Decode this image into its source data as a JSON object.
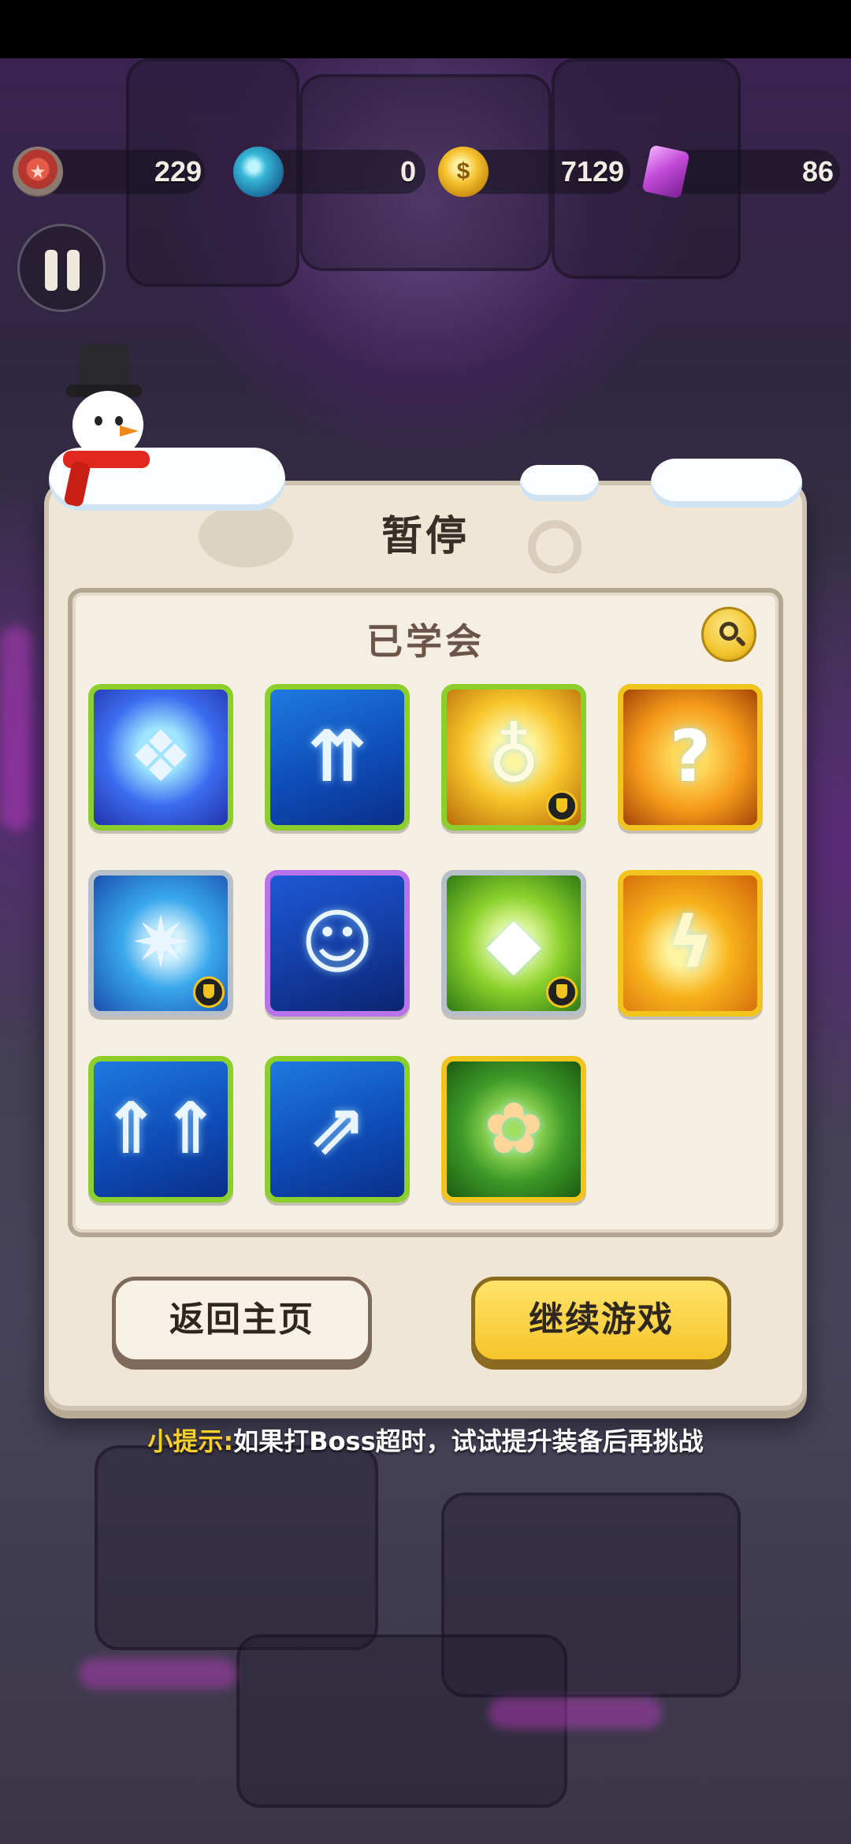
{
  "hud": {
    "medals": "229",
    "orbs": "0",
    "coins": "7129",
    "gems": "86"
  },
  "dialog": {
    "title": "暂停",
    "learned_title": "已学会"
  },
  "skills": [
    {
      "name": "ice-crystal-skill",
      "rarity": "green",
      "icon": "ice-cube-icon",
      "shield": false
    },
    {
      "name": "triple-arrow-up-skill",
      "rarity": "green",
      "icon": "triple-arrow-up-icon",
      "shield": false
    },
    {
      "name": "angel-bubble-skill",
      "rarity": "green",
      "icon": "angel-bubble-icon",
      "shield": true
    },
    {
      "name": "mystery-hammer-skill",
      "rarity": "gold",
      "icon": "hammer-question-icon",
      "shield": false
    },
    {
      "name": "frost-star-skill",
      "rarity": "silver",
      "icon": "frost-star-icon",
      "shield": true
    },
    {
      "name": "demon-spirit-skill",
      "rarity": "purple",
      "icon": "demon-spirit-icon",
      "shield": false
    },
    {
      "name": "lightning-gem-skill",
      "rarity": "silver",
      "icon": "lightning-gem-icon",
      "shield": true
    },
    {
      "name": "fire-spear-skill",
      "rarity": "gold",
      "icon": "fire-spear-icon",
      "shield": false
    },
    {
      "name": "double-arrow-up-skill",
      "rarity": "green",
      "icon": "double-arrow-up-icon",
      "shield": false
    },
    {
      "name": "diagonal-arrows-skill",
      "rarity": "green",
      "icon": "diagonal-arrows-icon",
      "shield": false
    },
    {
      "name": "vine-monster-skill",
      "rarity": "gold",
      "icon": "vine-monster-icon",
      "shield": false
    }
  ],
  "buttons": {
    "home": "返回主页",
    "continue": "继续游戏"
  },
  "tip": {
    "label": "小提示:",
    "text": "如果打Boss超时，试试提升装备后再挑战"
  },
  "colors": {
    "rarity_green": "#8ccf2a",
    "rarity_gold": "#f2c41e",
    "rarity_silver": "#b7c0c8",
    "rarity_purple": "#b873e8",
    "tip_label": "#f6cf2a"
  }
}
